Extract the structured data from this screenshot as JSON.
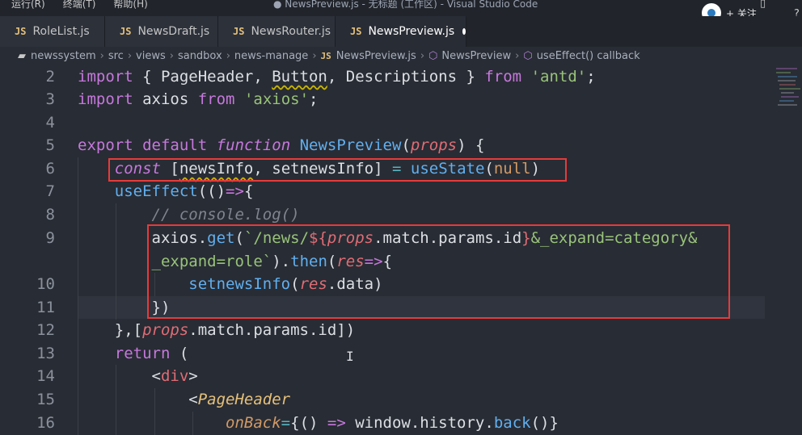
{
  "window": {
    "menu": [
      "运行(R)",
      "终端(T)",
      "帮助(H)"
    ],
    "title": "● NewsPreview.js - 无标题 (工作区) - Visual Studio Code",
    "follow_label": "+ 关注"
  },
  "tabs": [
    {
      "icon": "JS",
      "label": "RoleList.js"
    },
    {
      "icon": "JS",
      "label": "NewsDraft.js"
    },
    {
      "icon": "JS",
      "label": "NewsRouter.js"
    },
    {
      "icon": "JS",
      "label": "NewsPreview.js",
      "active": true,
      "modified": true
    }
  ],
  "breadcrumb": [
    "newssystem",
    "src",
    "views",
    "sandbox",
    "news-manage",
    "NewsPreview.js",
    "NewsPreview",
    "useEffect() callback"
  ],
  "breadcrumb_js": "JS",
  "editor": {
    "lines": [
      {
        "num": "2"
      },
      {
        "num": "3"
      },
      {
        "num": ""
      },
      {
        "num": "5"
      },
      {
        "num": "6"
      },
      {
        "num": "7"
      },
      {
        "num": "8"
      },
      {
        "num": "9"
      },
      {
        "num": ""
      },
      {
        "num": "10"
      },
      {
        "num": "11"
      },
      {
        "num": "12"
      },
      {
        "num": "13"
      },
      {
        "num": "14"
      },
      {
        "num": "15"
      },
      {
        "num": "16"
      }
    ],
    "empty_line_number": "4"
  },
  "colors": {
    "editor_bg": "#282c34",
    "keyword": "#c678dd",
    "function": "#61afef",
    "string": "#98c379",
    "highlight_box": "#e83a3a"
  }
}
